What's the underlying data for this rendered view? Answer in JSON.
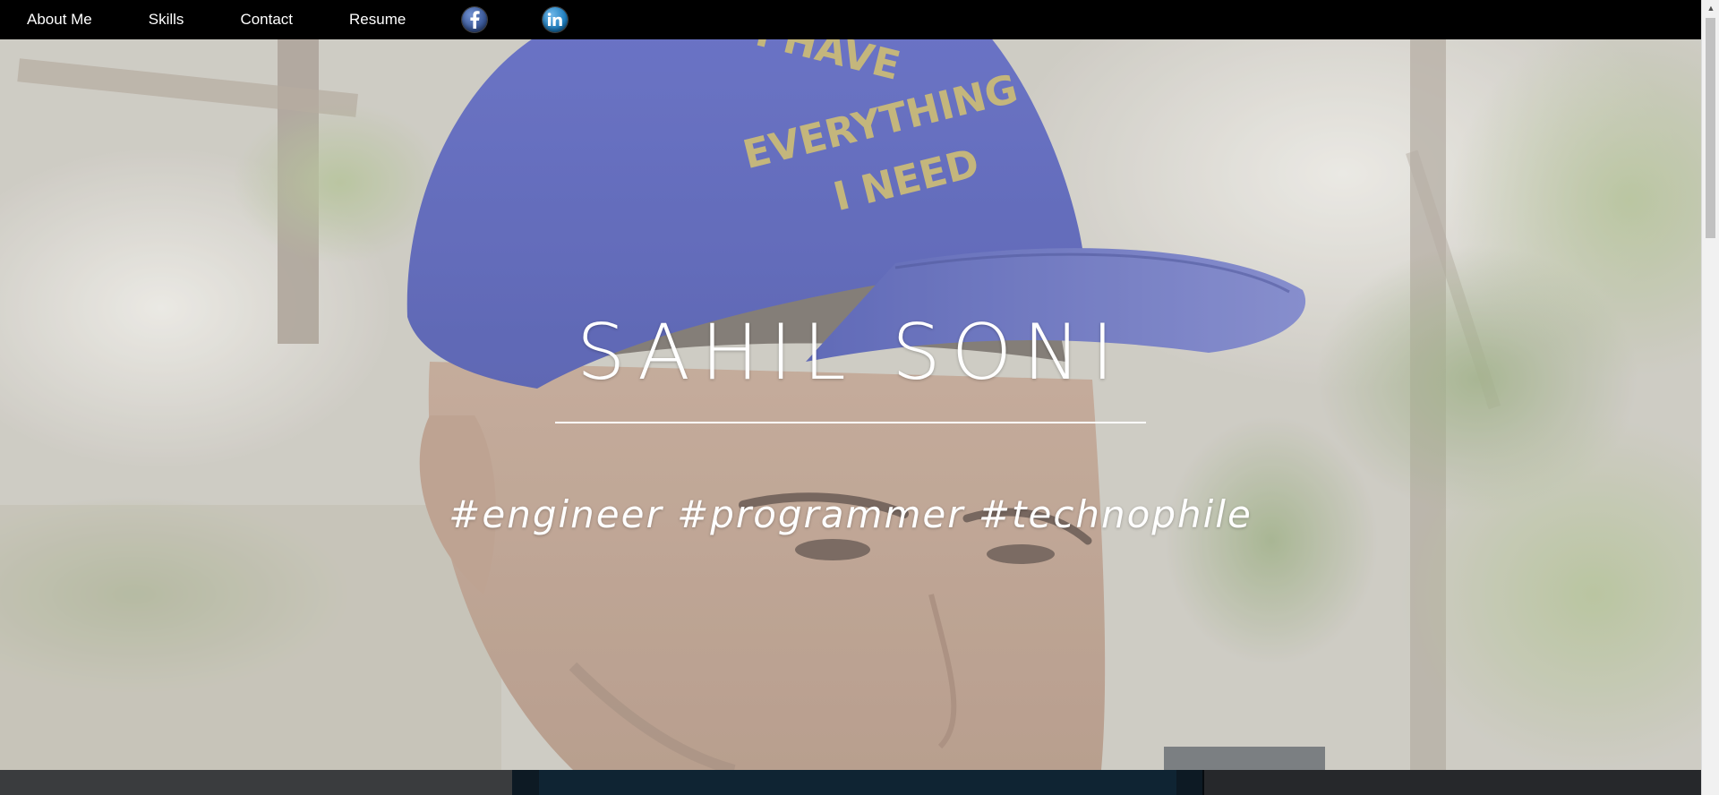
{
  "nav": {
    "links": [
      {
        "label": "About Me"
      },
      {
        "label": "Skills"
      },
      {
        "label": "Contact"
      },
      {
        "label": "Resume"
      }
    ],
    "social": [
      {
        "icon": "facebook-icon",
        "color": "#3b5998"
      },
      {
        "icon": "linkedin-icon",
        "color": "#1f7fc0"
      }
    ],
    "background": "#000000"
  },
  "hero": {
    "title": "SAHIL SONI",
    "tagline": "#engineer #programmer #technophile",
    "background_image": "portrait-photo-blue-cap"
  },
  "scrollbar": {
    "up_arrow_icon": "scroll-up-arrow-icon"
  }
}
